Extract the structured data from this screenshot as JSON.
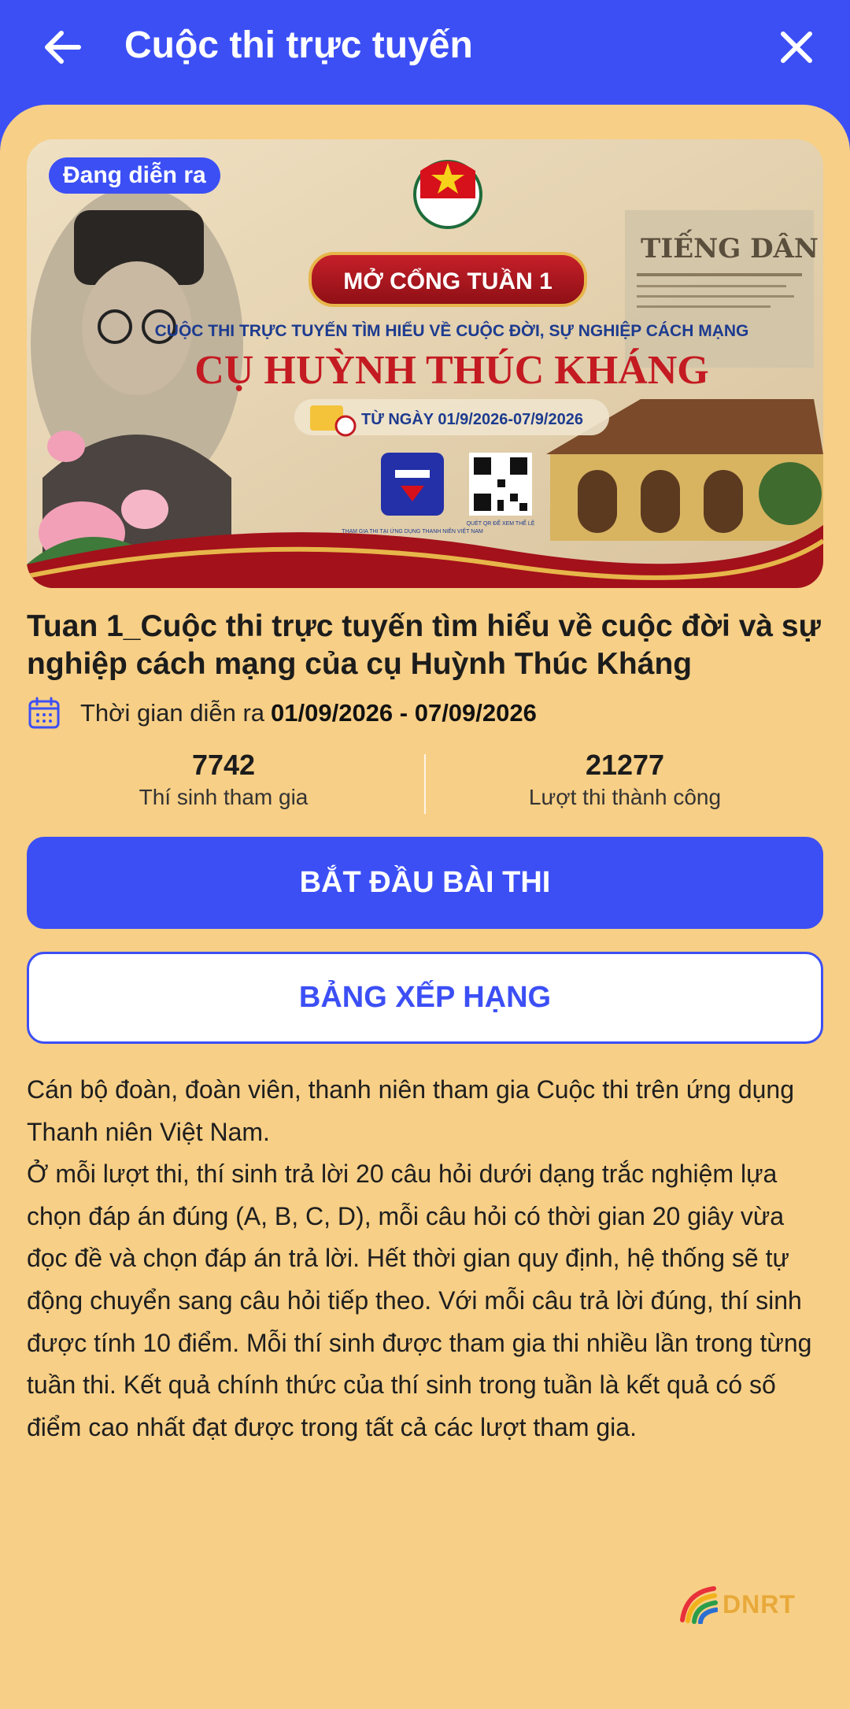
{
  "header": {
    "title": "Cuộc thi trực tuyến",
    "back_icon": "arrow-left-icon",
    "close_icon": "close-icon"
  },
  "banner": {
    "status_badge": "Đang diễn ra",
    "headline": "MỞ CỔNG TUẦN 1",
    "subtitle": "CUỘC THI TRỰC TUYẾN TÌM HIỂU VỀ CUỘC ĐỜI, SỰ NGHIỆP CÁCH MẠNG",
    "name": "CỤ HUỲNH THÚC KHÁNG",
    "dates": "TỪ NGÀY 01/9/2026-07/9/2026",
    "newspaper": "TIẾNG DÂN",
    "app_caption": "THAM GIA THI TẠI ỨNG DỤNG THANH NIÊN VIỆT NAM",
    "qr_caption": "QUÉT QR ĐỂ XEM THỂ LỆ"
  },
  "contest": {
    "title": "Tuan 1_Cuộc thi trực tuyến tìm hiểu về cuộc đời  và sự nghiệp cách mạng của cụ Huỳnh Thúc Kháng",
    "time_label": "Thời gian diễn ra",
    "time_range": "01/09/2026 - 07/09/2026"
  },
  "stats": {
    "participants_value": "7742",
    "participants_label": "Thí sinh tham gia",
    "completed_value": "21277",
    "completed_label": "Lượt thi thành công"
  },
  "buttons": {
    "start": "BẮT ĐẦU BÀI THI",
    "ranking": "BẢNG XẾP HẠNG"
  },
  "description": {
    "paragraph1": "Cán bộ đoàn, đoàn viên, thanh niên tham gia Cuộc thi trên ứng dụng Thanh niên Việt Nam.",
    "paragraph2": "Ở mỗi lượt thi, thí sinh trả lời 20 câu hỏi dưới dạng trắc nghiệm lựa chọn đáp án đúng (A, B, C, D), mỗi câu hỏi có thời gian 20 giây vừa đọc đề và chọn đáp án trả lời. Hết thời gian quy định, hệ thống sẽ tự động chuyển sang câu hỏi tiếp theo. Với mỗi câu trả lời đúng, thí sinh được tính 10 điểm. Mỗi thí sinh được tham gia thi nhiều lần trong từng tuần thi. Kết quả chính thức của thí sinh trong tuần là kết quả có số điểm cao nhất đạt được trong tất cả các lượt tham gia."
  },
  "watermark": {
    "text": "DNRT"
  },
  "colors": {
    "primary": "#3c4ff5",
    "background": "#f7cf86",
    "banner_red": "#b3141b",
    "gold": "#e7b64a"
  }
}
